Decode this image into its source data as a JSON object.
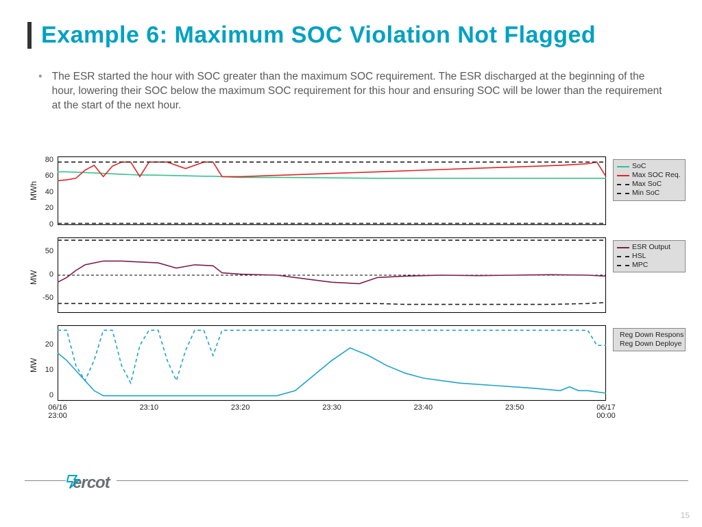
{
  "title": "Example 6: Maximum SOC Violation Not Flagged",
  "bullet": "The ESR started the hour with SOC greater than the maximum SOC requirement. The ESR discharged at the beginning of the hour, lowering their SOC below the maximum SOC requirement for this hour and ensuring SOC will be lower than the requirement at the start of the next hour.",
  "page_number": "15",
  "brand": "ercot",
  "xaxis": {
    "labels": [
      "06/16\n23:00",
      "23:10",
      "23:20",
      "23:30",
      "23:40",
      "23:50",
      "06/17\n00:00"
    ],
    "positions": [
      0,
      10,
      20,
      30,
      40,
      50,
      60
    ]
  },
  "chart_data": [
    {
      "type": "line",
      "ylabel": "MWh",
      "ylim": [
        0,
        85
      ],
      "yticks": [
        0,
        20,
        40,
        60,
        80
      ],
      "x": [
        0,
        1,
        2,
        3,
        4,
        5,
        6,
        7,
        8,
        9,
        10,
        12,
        14,
        16,
        17,
        18,
        20,
        25,
        30,
        35,
        40,
        45,
        50,
        55,
        58,
        59,
        60
      ],
      "series": [
        {
          "name": "SoC",
          "color": "#35c28c",
          "dash": "",
          "values": [
            66,
            66,
            65.5,
            65,
            64.5,
            64,
            63.5,
            63,
            62.5,
            62,
            62,
            61.5,
            61,
            60.5,
            60.5,
            60,
            59,
            59,
            58.5,
            58,
            58,
            58,
            58,
            58,
            58,
            58,
            58
          ]
        },
        {
          "name": "Max SOC Req.",
          "color": "#e02424",
          "dash": "",
          "values": [
            55,
            56,
            58,
            68,
            74,
            60,
            73,
            78,
            78,
            60,
            78,
            78,
            70,
            78,
            78,
            60,
            60,
            62,
            64,
            66,
            68,
            70,
            72,
            74,
            76,
            78,
            60
          ]
        },
        {
          "name": "Max SoC",
          "color": "#222",
          "dash": "6,4",
          "values": [
            78,
            78,
            78,
            78,
            78,
            78,
            78,
            78,
            78,
            78,
            78,
            78,
            78,
            78,
            78,
            78,
            78,
            78,
            78,
            78,
            78,
            78,
            78,
            78,
            78,
            78,
            78
          ]
        },
        {
          "name": "Min SoC",
          "color": "#222",
          "dash": "6,4",
          "values": [
            2,
            2,
            2,
            2,
            2,
            2,
            2,
            2,
            2,
            2,
            2,
            2,
            2,
            2,
            2,
            2,
            2,
            2,
            2,
            2,
            2,
            2,
            2,
            2,
            2,
            2,
            2
          ]
        }
      ]
    },
    {
      "type": "line",
      "ylabel": "MW",
      "ylim": [
        -80,
        80
      ],
      "yticks": [
        -50,
        0,
        50
      ],
      "x": [
        0,
        1,
        2,
        3,
        5,
        7,
        9,
        11,
        13,
        15,
        17,
        18,
        20,
        22,
        24,
        26,
        28,
        30,
        33,
        35,
        38,
        42,
        46,
        50,
        54,
        58,
        60
      ],
      "series": [
        {
          "name": "ESR Output",
          "color": "#7a1f4d",
          "dash": "",
          "values": [
            -15,
            -5,
            10,
            22,
            30,
            30,
            28,
            26,
            15,
            22,
            20,
            5,
            2,
            1,
            0,
            -5,
            -10,
            -15,
            -18,
            -5,
            -2,
            0,
            -1,
            0,
            1,
            0,
            -2
          ]
        },
        {
          "name": "HSL",
          "color": "#222",
          "dash": "6,4",
          "values": [
            74,
            74,
            74,
            74,
            74,
            74,
            74,
            74,
            74,
            74,
            74,
            74,
            74,
            74,
            74,
            74,
            74,
            74,
            74,
            74,
            74,
            74,
            74,
            74,
            74,
            74,
            74
          ]
        },
        {
          "name": "MPC",
          "color": "#222",
          "dash": "6,4",
          "values": [
            -60,
            -60,
            -60,
            -60,
            -60,
            -60,
            -60,
            -60,
            -60,
            -60,
            -60,
            -60,
            -60,
            -60,
            -60,
            -60,
            -60,
            -60,
            -60,
            -60,
            -62,
            -62,
            -62,
            -62,
            -62,
            -60,
            -58
          ]
        }
      ],
      "zero_line": true
    },
    {
      "type": "line",
      "ylabel": "MW",
      "ylim": [
        -2,
        28
      ],
      "yticks": [
        0,
        10,
        20
      ],
      "x": [
        0,
        1,
        2,
        3,
        4,
        5,
        6,
        7,
        8,
        9,
        10,
        11,
        12,
        13,
        14,
        15,
        16,
        17,
        18,
        20,
        22,
        24,
        26,
        28,
        30,
        32,
        34,
        36,
        38,
        40,
        44,
        48,
        52,
        55,
        56,
        57,
        58,
        59,
        60
      ],
      "series": [
        {
          "name": "Reg Down Respons",
          "color": "#1fa3c9",
          "dash": "5,4",
          "values": [
            26,
            26,
            12,
            6,
            14,
            26,
            26,
            12,
            5,
            20,
            26,
            26,
            14,
            6,
            18,
            26,
            26,
            16,
            26,
            26,
            26,
            26,
            26,
            26,
            26,
            26,
            26,
            26,
            26,
            26,
            26,
            26,
            26,
            26,
            26,
            26,
            26,
            20,
            20
          ]
        },
        {
          "name": "Reg Down Deploye",
          "color": "#1fa3c9",
          "dash": "",
          "values": [
            17,
            14,
            10,
            6,
            2,
            0,
            0,
            0,
            0,
            0,
            0,
            0,
            0,
            0,
            0,
            0,
            0,
            0,
            0,
            0,
            0,
            0,
            2,
            8,
            14,
            19,
            16,
            12,
            9,
            7,
            5,
            4,
            3,
            2,
            3.5,
            2,
            2,
            1.5,
            1
          ]
        }
      ]
    }
  ]
}
